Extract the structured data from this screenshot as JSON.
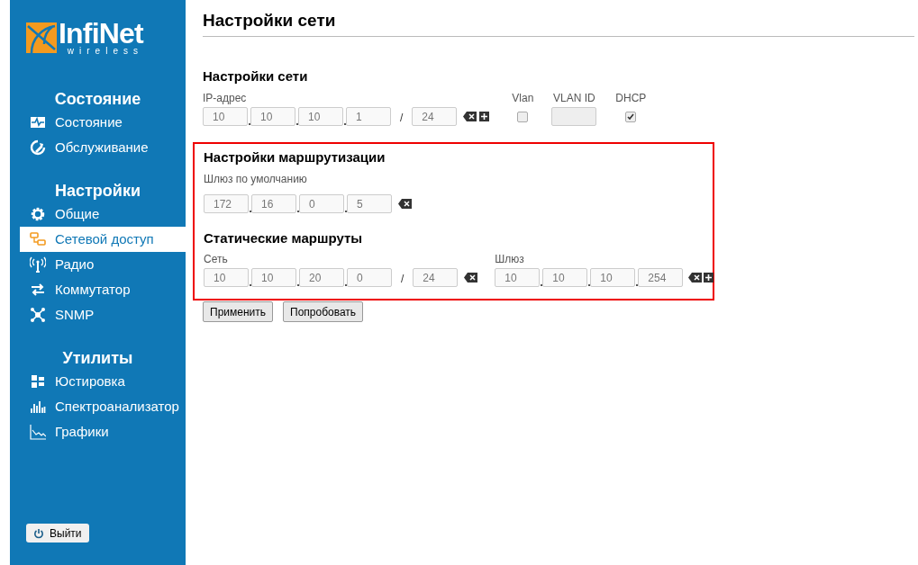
{
  "sidebar": {
    "logo": {
      "name": "InfiNet",
      "tagline": "wireless"
    },
    "groups": [
      {
        "title": "Состояние",
        "items": [
          {
            "label": "Состояние",
            "selected": false
          },
          {
            "label": "Обслуживание",
            "selected": false
          }
        ]
      },
      {
        "title": "Настройки",
        "items": [
          {
            "label": "Общие",
            "selected": false
          },
          {
            "label": "Сетевой доступ",
            "selected": true
          },
          {
            "label": "Радио",
            "selected": false
          },
          {
            "label": "Коммутатор",
            "selected": false
          },
          {
            "label": "SNMP",
            "selected": false
          }
        ]
      },
      {
        "title": "Утилиты",
        "items": [
          {
            "label": "Юстировка",
            "selected": false
          },
          {
            "label": "Спектроанализатор",
            "selected": false
          },
          {
            "label": "Графики",
            "selected": false
          }
        ]
      }
    ],
    "logout": "Выйти"
  },
  "page_title": "Настройки сети",
  "network": {
    "title": "Настройки сети",
    "ip_label": "IP-адрес",
    "ip": [
      "10",
      "10",
      "10",
      "1"
    ],
    "slash": "/",
    "mask": "24",
    "vlan_label": "Vlan",
    "vlan_checked": false,
    "vlan_id_label": "VLAN ID",
    "dhcp_label": "DHCP",
    "dhcp_checked": true
  },
  "routing": {
    "highlighted": true,
    "title": "Настройки маршрутизации",
    "gateway_label": "Шлюз по умолчанию",
    "gateway": [
      "172",
      "16",
      "0",
      "5"
    ],
    "static_title": "Статические маршруты",
    "net_label": "Сеть",
    "net": [
      "10",
      "10",
      "20",
      "0"
    ],
    "slash": "/",
    "mask": "24",
    "route_gateway_label": "Шлюз",
    "route_gateway": [
      "10",
      "10",
      "10",
      "254"
    ]
  },
  "buttons": [
    "Применить",
    "Попробовать"
  ]
}
